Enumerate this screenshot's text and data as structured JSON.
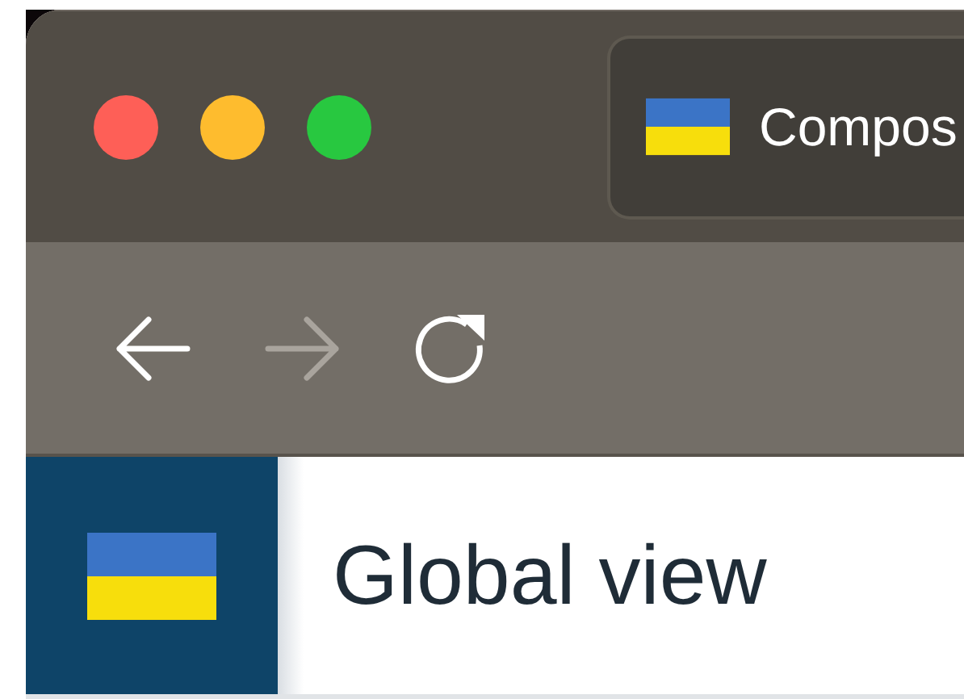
{
  "browser": {
    "tab": {
      "title": "Compos"
    },
    "toolbar": {
      "buttons": [
        {
          "kind": "back",
          "disabled": false
        },
        {
          "kind": "forward",
          "disabled": true
        },
        {
          "kind": "reload",
          "disabled": false
        }
      ]
    }
  },
  "page": {
    "heading": "Global view"
  }
}
